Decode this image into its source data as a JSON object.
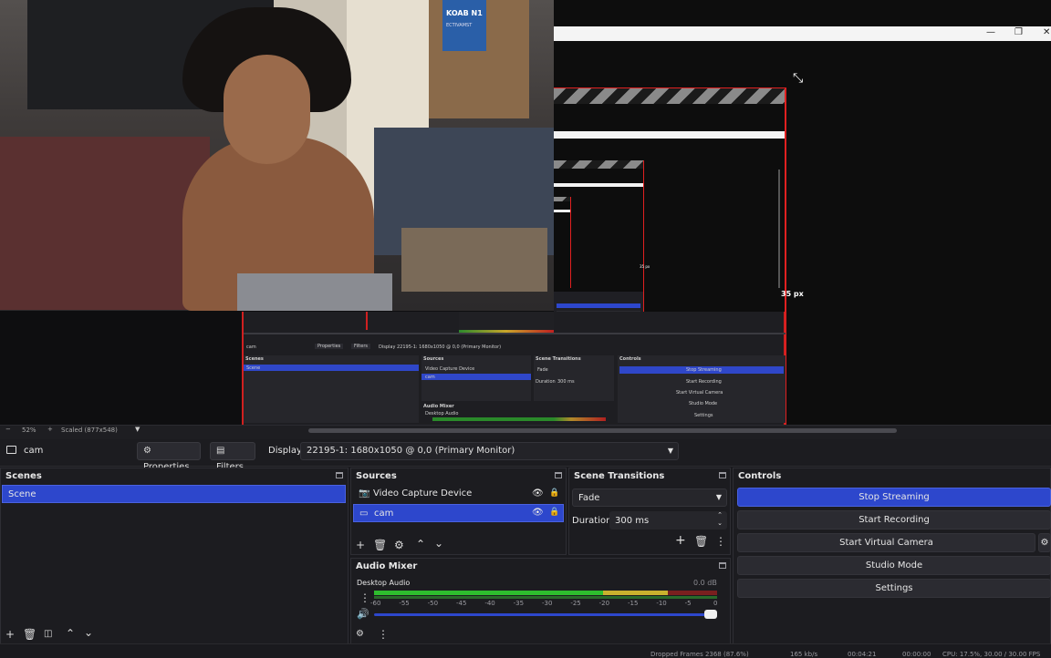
{
  "preview": {
    "zoom": "52%",
    "scaled": "Scaled (877x548)",
    "px_label": "35 px",
    "px_label_small": "35 px",
    "poster_text": "KOAB N1",
    "poster_sub": "ECTIVAMST"
  },
  "mini_obs": {
    "source_name": "cam",
    "properties": "Properties",
    "filters": "Filters",
    "display": "Display",
    "display_value": "22195-1: 1680x1050 @ 0,0 (Primary Monitor)",
    "scenes_title": "Scenes",
    "scene_item": "Scene",
    "sources_title": "Sources",
    "source_1": "Video Capture Device",
    "source_2": "cam",
    "transitions_title": "Scene Transitions",
    "fade": "Fade",
    "duration": "Duration",
    "duration_val": "300 ms",
    "controls_title": "Controls",
    "stop_streaming": "Stop Streaming",
    "start_recording": "Start Recording",
    "start_virtual": "Start Virtual Camera",
    "studio_mode": "Studio Mode",
    "settings": "Settings",
    "audio_mixer": "Audio Mixer",
    "desktop_audio": "Desktop Audio"
  },
  "toolbar": {
    "source_name": "cam",
    "properties": "Properties",
    "filters": "Filters",
    "display_label": "Display",
    "display_value": "22195-1: 1680x1050 @ 0,0 (Primary Monitor)"
  },
  "scenes": {
    "title": "Scenes",
    "items": [
      "Scene"
    ]
  },
  "sources": {
    "title": "Sources",
    "items": [
      "Video Capture Device",
      "cam"
    ]
  },
  "transitions": {
    "title": "Scene Transitions",
    "type": "Fade",
    "duration_label": "Duration",
    "duration_value": "300 ms"
  },
  "controls": {
    "title": "Controls",
    "stop_streaming": "Stop Streaming",
    "start_recording": "Start Recording",
    "start_virtual_camera": "Start Virtual Camera",
    "studio_mode": "Studio Mode",
    "settings": "Settings"
  },
  "audio_mixer": {
    "title": "Audio Mixer",
    "channel": "Desktop Audio",
    "db": "0.0 dB",
    "ticks": [
      "-60",
      "-55",
      "-50",
      "-45",
      "-40",
      "-35",
      "-30",
      "-25",
      "-20",
      "-15",
      "-10",
      "-5",
      "0"
    ],
    "volume_fraction": 1.0
  },
  "statusbar": {
    "dropped": "Dropped Frames 2368 (87.6%)",
    "kbps": "165 kb/s",
    "live": "00:04:21",
    "rec": "00:00:00",
    "cpu": "CPU: 17.5%, 30.00 / 30.00 FPS"
  },
  "colors": {
    "accent": "#2d47cc",
    "border_red": "#e02020"
  }
}
